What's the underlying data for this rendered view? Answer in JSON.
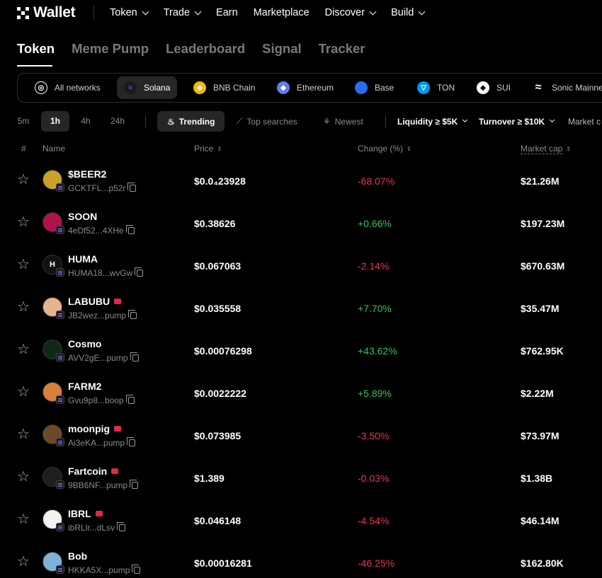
{
  "brand": {
    "name": "Wallet"
  },
  "nav": {
    "items": [
      {
        "label": "Token",
        "dropdown": true
      },
      {
        "label": "Trade",
        "dropdown": true
      },
      {
        "label": "Earn",
        "dropdown": false
      },
      {
        "label": "Marketplace",
        "dropdown": false
      },
      {
        "label": "Discover",
        "dropdown": true
      },
      {
        "label": "Build",
        "dropdown": true
      }
    ]
  },
  "tabs": [
    "Token",
    "Meme Pump",
    "Leaderboard",
    "Signal",
    "Tracker"
  ],
  "active_tab": "Token",
  "networks": [
    {
      "label": "All networks",
      "icon": "globe-icon",
      "color": "#ffffff"
    },
    {
      "label": "Solana",
      "icon": "solana-icon",
      "color": "#9945ff",
      "active": true
    },
    {
      "label": "BNB Chain",
      "icon": "bnb-icon",
      "color": "#f0b90b"
    },
    {
      "label": "Ethereum",
      "icon": "ethereum-icon",
      "color": "#627eea"
    },
    {
      "label": "Base",
      "icon": "base-icon",
      "color": "#2a6cf5"
    },
    {
      "label": "TON",
      "icon": "ton-icon",
      "color": "#0098ea"
    },
    {
      "label": "SUI",
      "icon": "sui-icon",
      "color": "#ffffff"
    },
    {
      "label": "Sonic Mainnet",
      "icon": "sonic-icon",
      "color": "#ffffff"
    }
  ],
  "filters": {
    "timeframes": [
      "5m",
      "1h",
      "4h",
      "24h"
    ],
    "active_timeframe": "1h",
    "modes": [
      {
        "label": "Trending",
        "icon": "flame-icon",
        "active": true
      },
      {
        "label": "Top searches",
        "icon": "chart-icon"
      },
      {
        "label": "Newest",
        "icon": "sprout-icon"
      }
    ],
    "dropdowns": [
      "Liquidity ≥ $5K",
      "Turnover ≥ $10K",
      "Market c"
    ]
  },
  "table": {
    "headers": {
      "index": "#",
      "name": "Name",
      "price": "Price",
      "change": "Change (%)",
      "mcap": "Market cap"
    },
    "rows": [
      {
        "symbol": "$BEER2",
        "address": "GCKTFL...p52r",
        "price": "$0.0₄23928",
        "change": "-68.07%",
        "trend": "down",
        "mcap": "$21.26M",
        "pump_badge": false,
        "avatar_color": "#c9a227"
      },
      {
        "symbol": "SOON",
        "address": "4eDf52...4XHe",
        "price": "$0.38626",
        "change": "+0.66%",
        "trend": "up",
        "mcap": "$197.23M",
        "pump_badge": false,
        "avatar_color": "#b0124a"
      },
      {
        "symbol": "HUMA",
        "address": "HUMA18...wvGw",
        "price": "$0.067063",
        "change": "-2.14%",
        "trend": "down",
        "mcap": "$670.63M",
        "pump_badge": false,
        "avatar_color": "#111111",
        "avatar_letter": "H"
      },
      {
        "symbol": "LABUBU",
        "address": "JB2wez...pump",
        "price": "$0.035558",
        "change": "+7.70%",
        "trend": "up",
        "mcap": "$35.47M",
        "pump_badge": true,
        "avatar_color": "#e6b48a"
      },
      {
        "symbol": "Cosmo",
        "address": "AVV2gE...pump",
        "price": "$0.00076298",
        "change": "+43.62%",
        "trend": "up",
        "mcap": "$762.95K",
        "pump_badge": false,
        "avatar_color": "#0f2a14"
      },
      {
        "symbol": "FARM2",
        "address": "Gvu9p8...boop",
        "price": "$0.0022222",
        "change": "+5.89%",
        "trend": "up",
        "mcap": "$2.22M",
        "pump_badge": false,
        "avatar_color": "#d9813a"
      },
      {
        "symbol": "moonpig",
        "address": "Ai3eKA...pump",
        "price": "$0.073985",
        "change": "-3.50%",
        "trend": "down",
        "mcap": "$73.97M",
        "pump_badge": true,
        "avatar_color": "#6b4a2a"
      },
      {
        "symbol": "Fartcoin",
        "address": "9BB6NF...pump",
        "price": "$1.389",
        "change": "-0.03%",
        "trend": "down",
        "mcap": "$1.38B",
        "pump_badge": true,
        "avatar_color": "#1e1e1e"
      },
      {
        "symbol": "IBRL",
        "address": "ibRLlr...dLsv",
        "price": "$0.046148",
        "change": "-4.54%",
        "trend": "down",
        "mcap": "$46.14M",
        "pump_badge": true,
        "avatar_color": "#f2f2f2"
      },
      {
        "symbol": "Bob",
        "address": "HKKA5X...pump",
        "price": "$0.00016281",
        "change": "-46.25%",
        "trend": "down",
        "mcap": "$162.80K",
        "pump_badge": false,
        "avatar_color": "#7fb2d8"
      }
    ]
  }
}
